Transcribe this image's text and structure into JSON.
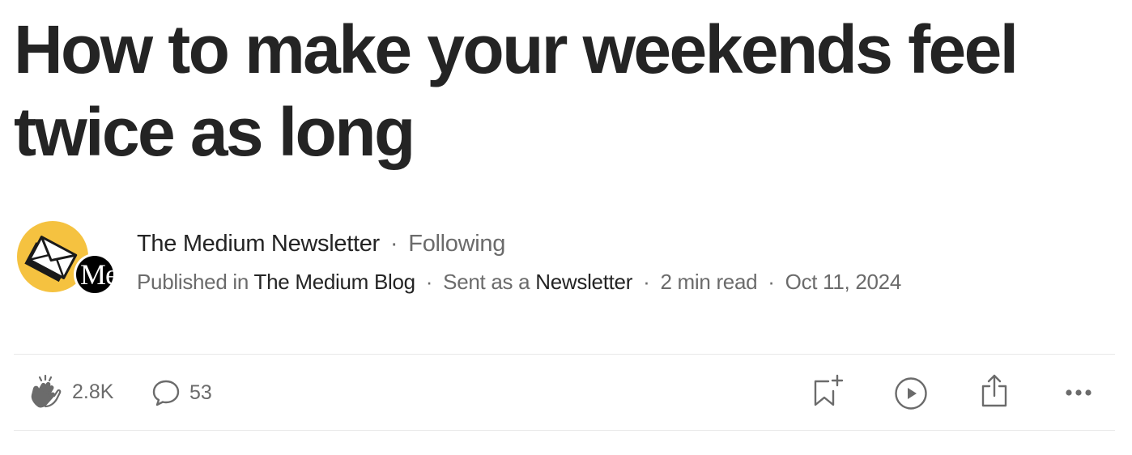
{
  "article": {
    "title": "How to make your weekends feel twice as long"
  },
  "byline": {
    "author": "The Medium Newsletter",
    "separator": "·",
    "follow_status": "Following",
    "published_prefix": "Published in",
    "publication": "The Medium Blog",
    "sent_prefix": "Sent as a",
    "sent_link": "Newsletter",
    "read_time": "2 min read",
    "date": "Oct 11, 2024",
    "avatar_icon": "envelope-icon",
    "publication_logo_text": "Me",
    "avatar_color": "#f5c240"
  },
  "actions": {
    "claps": "2.8K",
    "responses": "53",
    "clap_icon": "clap-icon",
    "response_icon": "speech-bubble-icon",
    "bookmark_icon": "bookmark-add-icon",
    "listen_icon": "play-icon",
    "share_icon": "share-icon",
    "more_icon": "more-dots-icon"
  },
  "colors": {
    "text_primary": "#242424",
    "text_secondary": "#6b6b6b",
    "divider": "#e8e8e8"
  }
}
